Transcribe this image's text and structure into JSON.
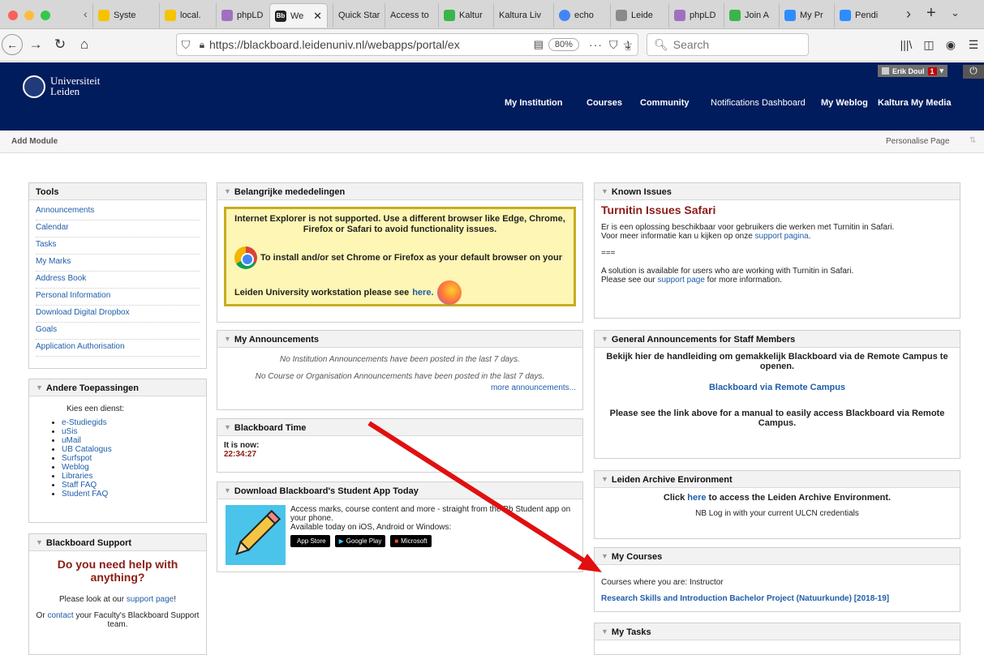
{
  "browser": {
    "tabs": [
      {
        "label": "Syste",
        "icon": "sunflower-icon"
      },
      {
        "label": "local.",
        "icon": "sunflower-icon"
      },
      {
        "label": "phpLD",
        "icon": "php-icon"
      },
      {
        "label": "We",
        "icon": "blackboard-icon",
        "favtext": "Bb"
      },
      {
        "label": "Quick Star",
        "icon": "none"
      },
      {
        "label": "Access to",
        "icon": "none"
      },
      {
        "label": "Kaltur",
        "icon": "kaltura-icon"
      },
      {
        "label": "Kaltura Liv",
        "icon": "none"
      },
      {
        "label": "echo",
        "icon": "google-icon"
      },
      {
        "label": "Leide",
        "icon": "leiden-icon"
      },
      {
        "label": "phpLD",
        "icon": "php-icon"
      },
      {
        "label": "Join A",
        "icon": "kaltura-icon"
      },
      {
        "label": "My Pr",
        "icon": "zoom-icon"
      },
      {
        "label": "Pendi",
        "icon": "zoom-icon"
      }
    ],
    "url": "https://blackboard.leidenuniv.nl/webapps/portal/ex",
    "zoom": "80%",
    "search_placeholder": "Search"
  },
  "header": {
    "logo_line1": "Universiteit",
    "logo_line2": "Leiden",
    "user": "Erik Doul",
    "notif_count": "1",
    "menu": [
      "My Institution",
      "Courses",
      "Community",
      "Notifications Dashboard",
      "My Weblog",
      "Kaltura My Media"
    ]
  },
  "subbar": {
    "add_module": "Add Module",
    "personalise": "Personalise Page"
  },
  "tools": {
    "title": "Tools",
    "items": [
      "Announcements",
      "Calendar",
      "Tasks",
      "My Marks",
      "Address Book",
      "Personal Information",
      "Download Digital Dropbox",
      "Goals",
      "Application Authorisation"
    ]
  },
  "andere": {
    "title": "Andere Toepassingen",
    "intro": "Kies een dienst:",
    "items": [
      "e-Studiegids",
      "uSis",
      "uMail",
      "UB Catalogus",
      "Surfspot",
      "Weblog",
      "Libraries",
      "Staff FAQ",
      "Student FAQ"
    ]
  },
  "support": {
    "title": "Blackboard Support",
    "heading": "Do you need help with anything?",
    "line1_pre": "Please look at  our ",
    "line1_link": "support page",
    "line1_post": "!",
    "line2_pre": "Or ",
    "line2_link": "contact",
    "line2_post": " your Faculty's Blackboard Support team."
  },
  "mededelingen": {
    "title": "Belangrijke mededelingen",
    "ie_text": "Internet Explorer is not supported. Use a different browser like Edge, Chrome, Firefox or Safari to avoid functionality issues.",
    "install_text": "To install and/or set Chrome or Firefox as your default browser on your",
    "workstation_text": "Leiden University workstation please see ",
    "here": "here."
  },
  "announcements": {
    "title": "My Announcements",
    "line1": "No Institution Announcements have been posted in the last 7 days.",
    "line2": "No Course or Organisation Announcements have been posted in the last 7 days.",
    "more": "more announcements..."
  },
  "bbtime": {
    "title": "Blackboard Time",
    "label": "It is now:",
    "time": "22:34:27"
  },
  "app": {
    "title": "Download Blackboard's Student App Today",
    "text1": "Access marks, course content and more - straight from the Bb Student app on your phone.",
    "text2": "Available today on iOS, Android or Windows:",
    "stores": [
      "App Store",
      "Google Play",
      "Microsoft"
    ]
  },
  "known": {
    "title": "Known Issues",
    "heading": "Turnitin Issues Safari",
    "nl1": "Er is een oplossing beschikbaar voor gebruikers die werken met Turnitin in Safari.",
    "nl2_pre": "Voor meer informatie kan u kijken op onze ",
    "nl2_link": "support pagina",
    "sep": "===",
    "en1": "A solution is available for users who are working with Turnitin in Safari.",
    "en2_pre": "Please see our ",
    "en2_link": "support page",
    "en2_post": " for more information."
  },
  "general": {
    "title": "General Announcements for Staff Members",
    "nl": "Bekijk hier de handleiding om gemakkelijk Blackboard via de Remote Campus te openen.",
    "link": "Blackboard via Remote Campus",
    "en": "Please see the link above for a manual to easily access Blackboard via Remote Campus."
  },
  "archive": {
    "title": "Leiden Archive Environment",
    "pre": "Click ",
    "link": "here",
    "post": " to access the Leiden Archive Environment.",
    "note": "NB Log in with your current ULCN credentials"
  },
  "courses": {
    "title": "My Courses",
    "label": "Courses where you are: Instructor",
    "course": "Research Skills and Introduction Bachelor Project (Natuurkunde) [2018-19]"
  },
  "tasks": {
    "title": "My Tasks"
  },
  "colors": {
    "header": "#001c5c",
    "link": "#1f5ea8",
    "arrow": "#e01010"
  }
}
